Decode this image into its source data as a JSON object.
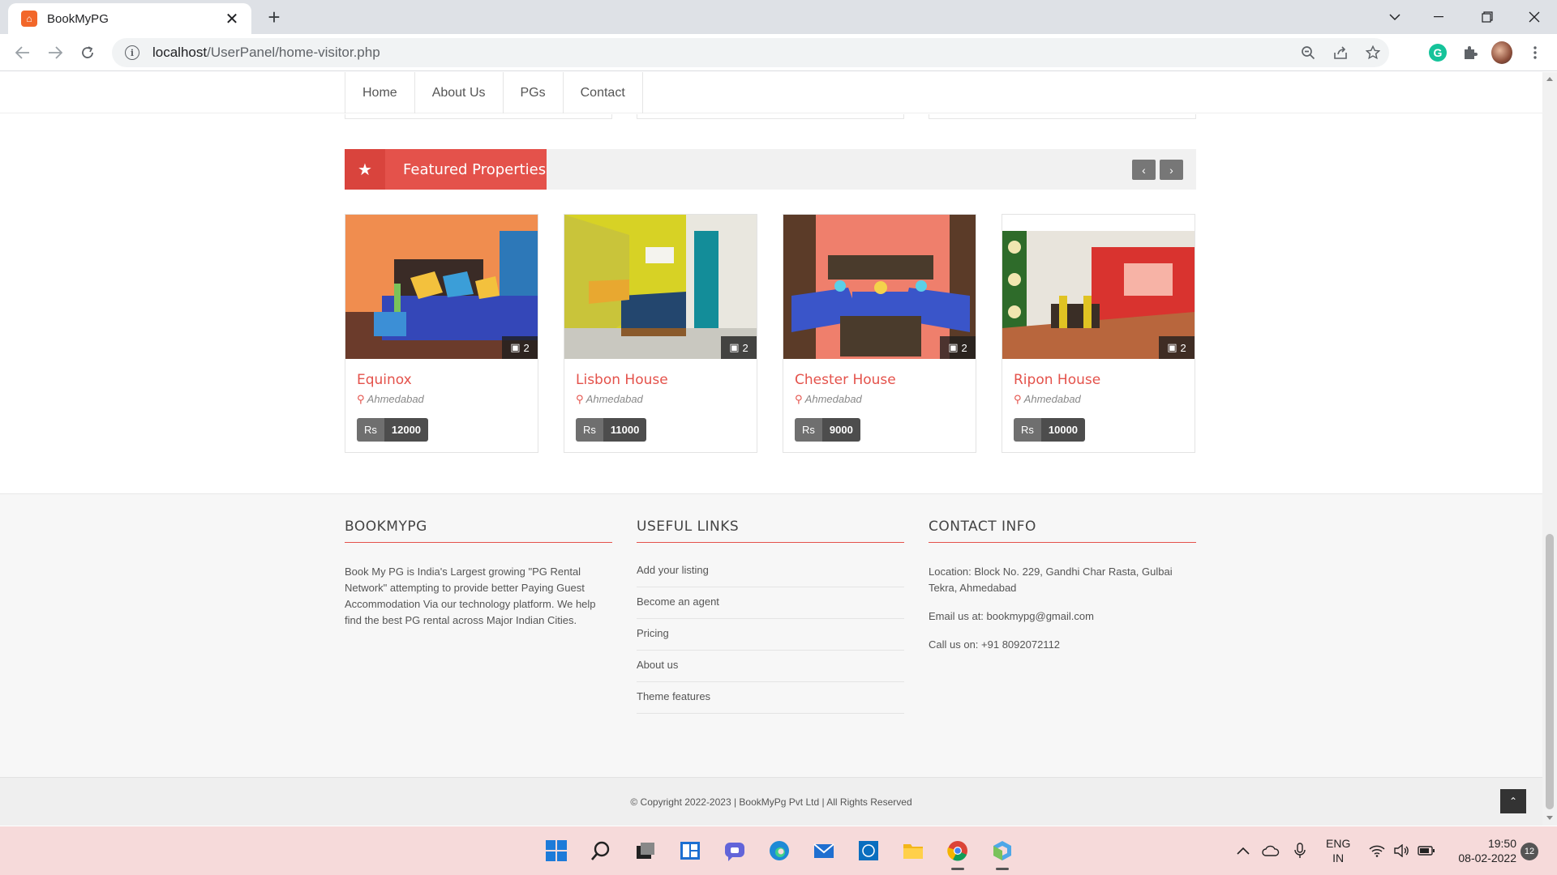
{
  "browser": {
    "tab_title": "BookMyPG",
    "url_host": "localhost",
    "url_path": "/UserPanel/home-visitor.php"
  },
  "site_nav": {
    "items": [
      {
        "label": "Home"
      },
      {
        "label": "About Us"
      },
      {
        "label": "PGs"
      },
      {
        "label": "Contact"
      }
    ]
  },
  "featured": {
    "title": "Featured Properties",
    "properties": [
      {
        "name": "Equinox",
        "city": "Ahmedabad",
        "currency": "Rs",
        "price": "12000",
        "photo_count": "2",
        "photo_palette": [
          "#f08d4f",
          "#3447b8",
          "#f3c13d"
        ]
      },
      {
        "name": "Lisbon House",
        "city": "Ahmedabad",
        "currency": "Rs",
        "price": "11000",
        "photo_count": "2",
        "photo_palette": [
          "#d7d225",
          "#23466e",
          "#e8a830"
        ]
      },
      {
        "name": "Chester House",
        "city": "Ahmedabad",
        "currency": "Rs",
        "price": "9000",
        "photo_count": "2",
        "photo_palette": [
          "#ef7f6c",
          "#3a55c9",
          "#4a3b2c"
        ]
      },
      {
        "name": "Ripon House",
        "city": "Ahmedabad",
        "currency": "Rs",
        "price": "10000",
        "photo_count": "2",
        "photo_palette": [
          "#c94a35",
          "#2e6b2a",
          "#d9332f"
        ]
      }
    ]
  },
  "footer": {
    "about": {
      "heading": "BOOKMYPG",
      "text": "Book My PG is India's Largest growing \"PG Rental Network\" attempting to provide better Paying Guest Accommodation Via our technology platform. We help find the best PG rental across Major Indian Cities."
    },
    "links": {
      "heading": "USEFUL LINKS",
      "items": [
        {
          "label": "Add your listing"
        },
        {
          "label": "Become an agent"
        },
        {
          "label": "Pricing"
        },
        {
          "label": "About us"
        },
        {
          "label": "Theme features"
        }
      ]
    },
    "contact": {
      "heading": "CONTACT INFO",
      "location": "Location: Block No. 229, Gandhi Char Rasta, Gulbai Tekra, Ahmedabad",
      "email": "Email us at: bookmypg@gmail.com",
      "phone": "Call us on: +91 8092072112"
    },
    "copyright": "© Copyright 2022-2023 | BookMyPg Pvt Ltd | All Rights Reserved"
  },
  "taskbar": {
    "lang_top": "ENG",
    "lang_bottom": "IN",
    "time": "19:50",
    "date": "08-02-2022",
    "notifications": "12"
  },
  "colors": {
    "accent": "#e4524b",
    "taskbar_bg": "#f6dada"
  }
}
